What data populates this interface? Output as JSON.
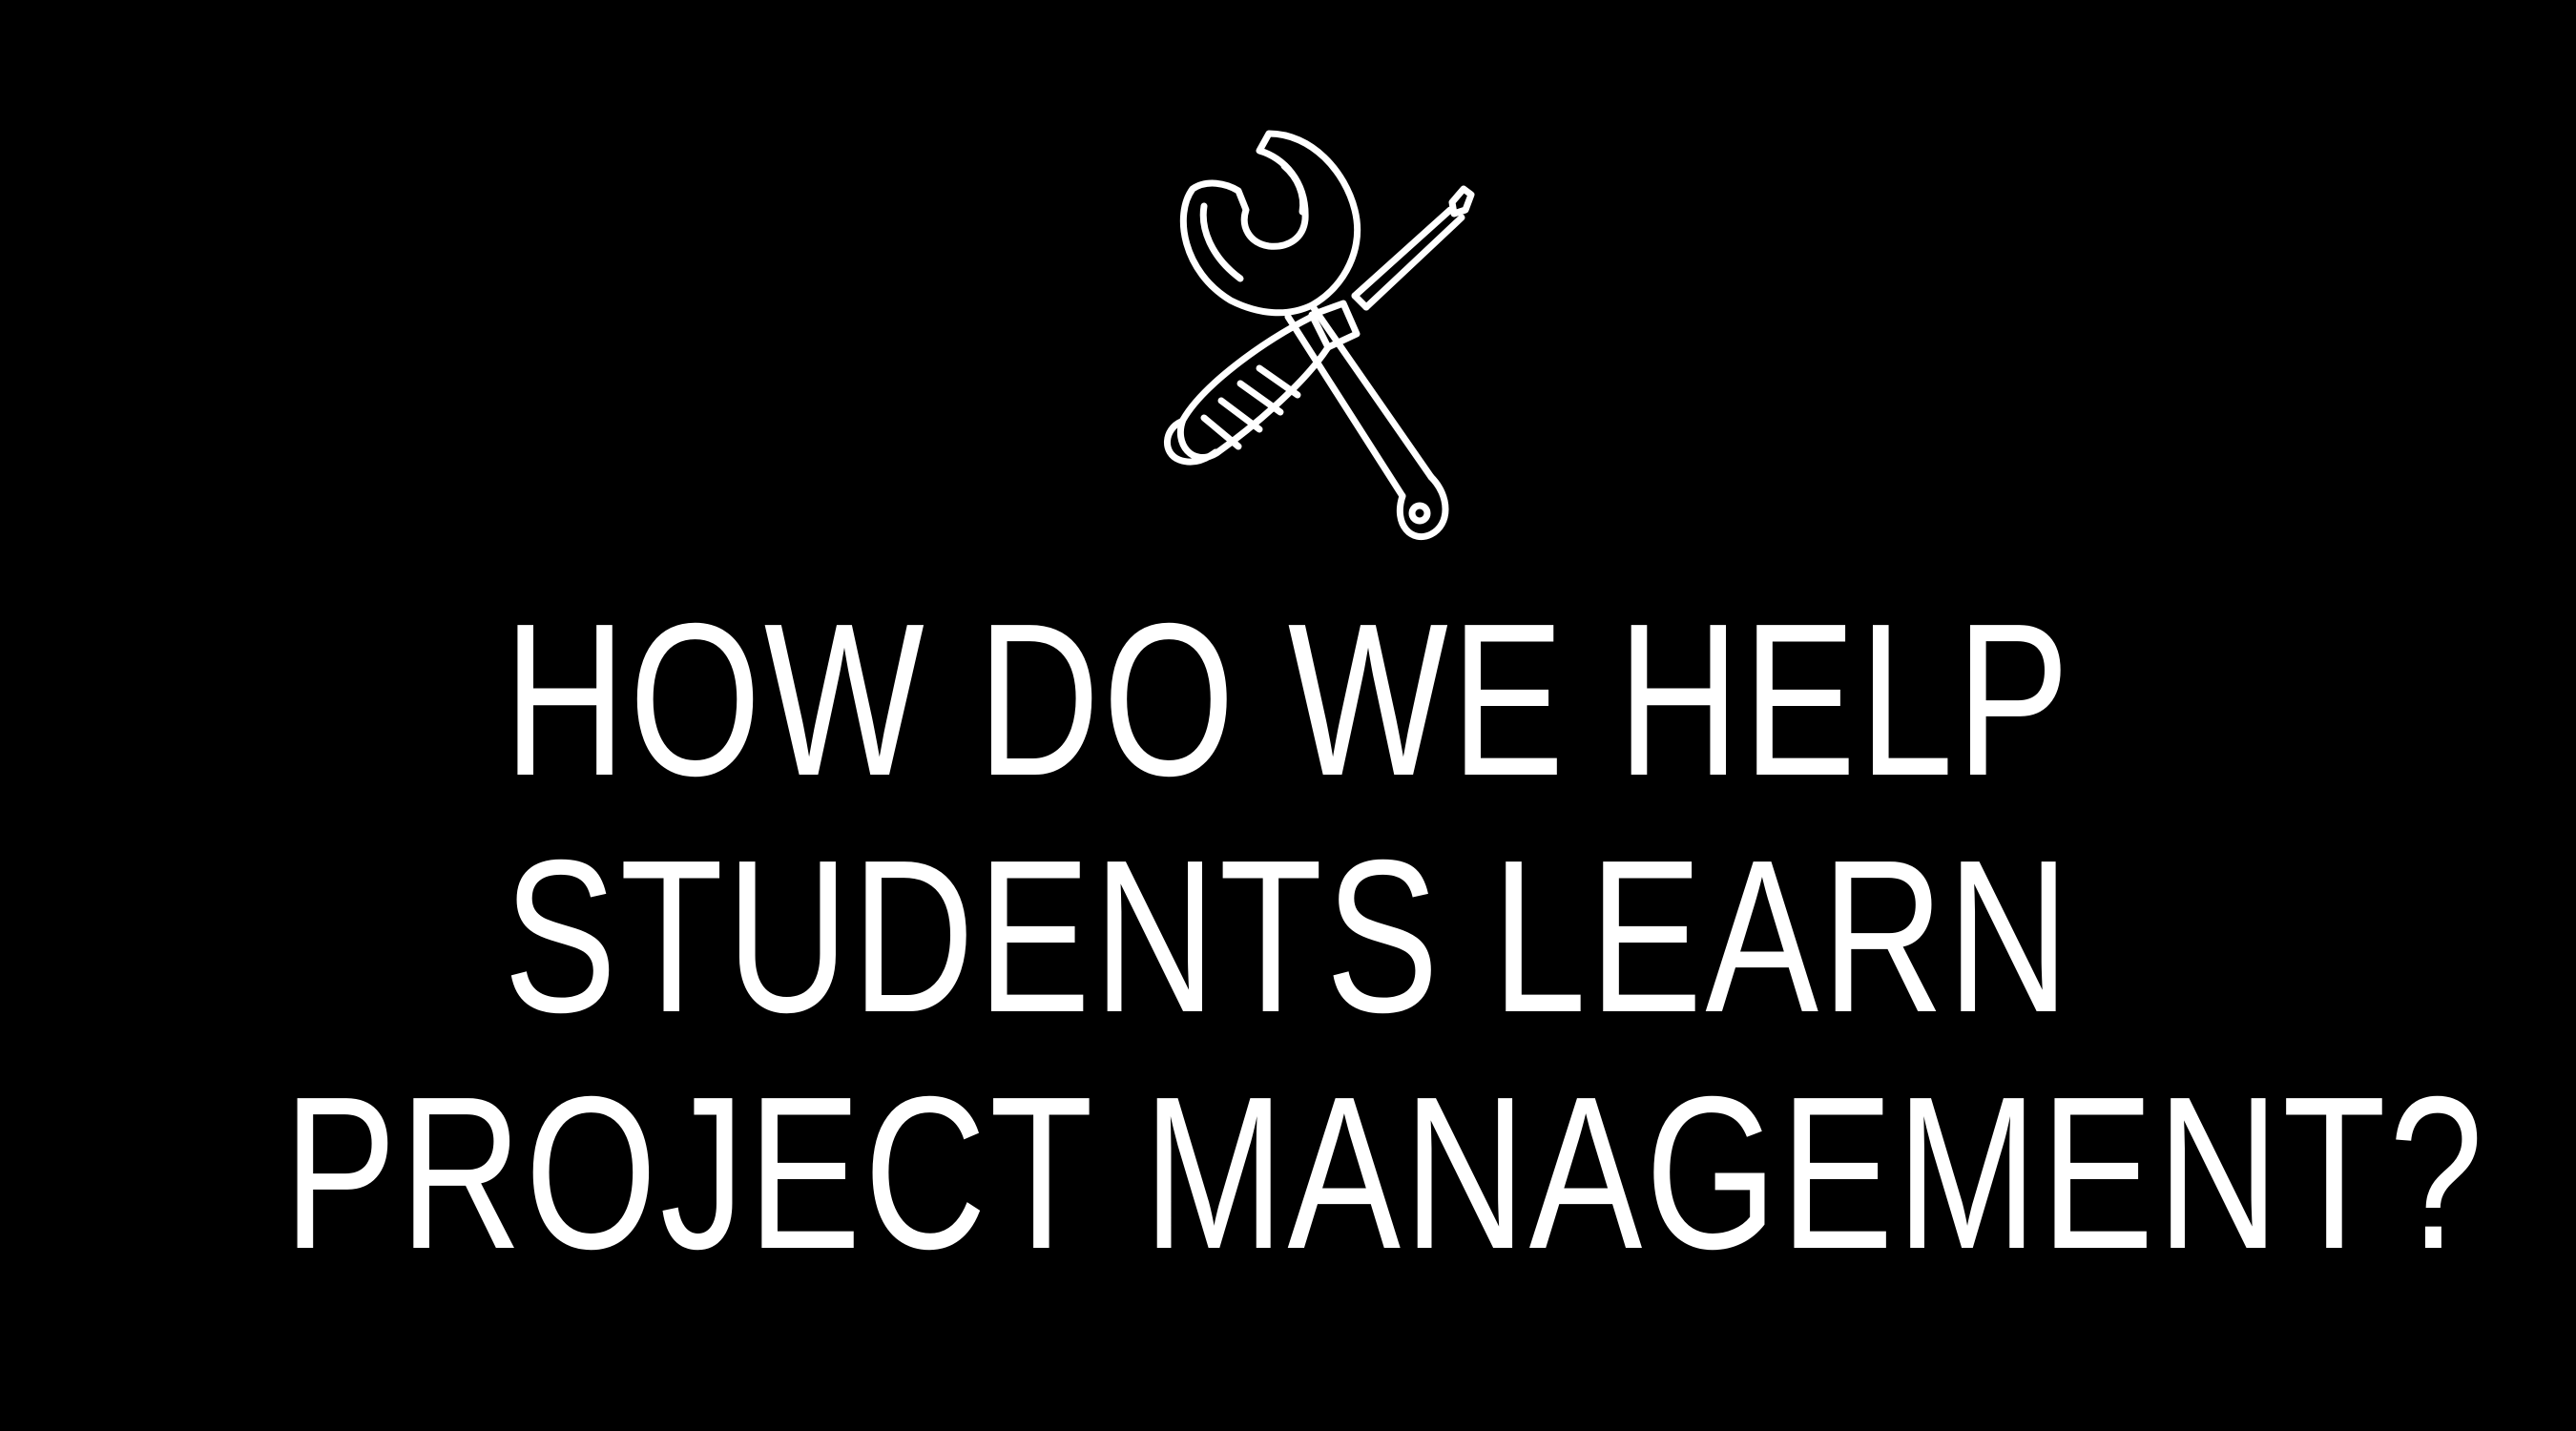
{
  "background_color": "#000000",
  "text_color": "#ffffff",
  "illustration": {
    "icon": "wrench-and-screwdriver-icon"
  },
  "headline": {
    "lines": [
      "HOW DO WE HELP",
      "STUDENTS LEARN",
      "PROJECT MANAGEMENT?"
    ]
  }
}
